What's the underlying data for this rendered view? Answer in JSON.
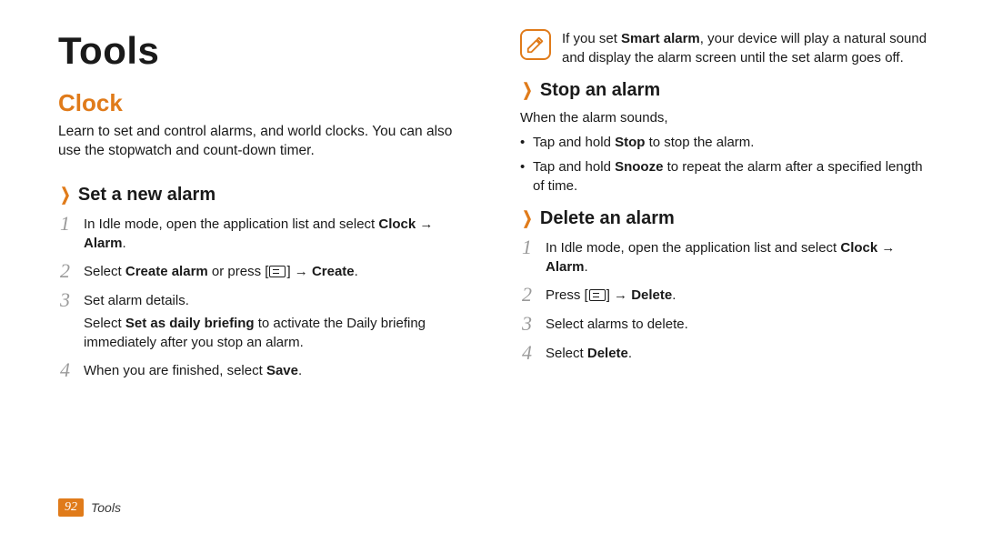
{
  "title": "Tools",
  "footer": {
    "pageNumber": "92",
    "sectionName": "Tools"
  },
  "left": {
    "heading": "Clock",
    "intro": "Learn to set and control alarms, and world clocks. You can also use the stopwatch and count-down timer.",
    "section1": {
      "title": "Set a new alarm",
      "steps": {
        "s1": {
          "pre": "In Idle mode, open the application list and select ",
          "b1": "Clock",
          "mid": " → ",
          "b2": "Alarm",
          "post": "."
        },
        "s2": {
          "pre": "Select ",
          "b1": "Create alarm",
          "mid": " or press [",
          "post": "] → ",
          "b2": "Create",
          "end": "."
        },
        "s3": {
          "line1": "Set alarm details.",
          "extraPre": "Select ",
          "extraB": "Set as daily briefing",
          "extraPost": " to activate the Daily briefing immediately after you stop an alarm."
        },
        "s4": {
          "pre": "When you are finished, select ",
          "b1": "Save",
          "post": "."
        }
      }
    }
  },
  "right": {
    "note": {
      "pre": "If you set ",
      "b1": "Smart alarm",
      "post": ", your device will play a natural sound and display the alarm screen until the set alarm goes off."
    },
    "section2": {
      "title": "Stop an alarm",
      "intro": "When the alarm sounds,",
      "bullets": {
        "b1": {
          "pre": "Tap and hold ",
          "bold": "Stop",
          "post": " to stop the alarm."
        },
        "b2": {
          "pre": "Tap and hold ",
          "bold": "Snooze",
          "post": " to repeat the alarm after a specified length of time."
        }
      }
    },
    "section3": {
      "title": "Delete an alarm",
      "steps": {
        "s1": {
          "pre": "In Idle mode, open the application list and select ",
          "b1": "Clock",
          "mid": " → ",
          "b2": "Alarm",
          "post": "."
        },
        "s2": {
          "pre": "Press [",
          "post": "] → ",
          "b1": "Delete",
          "end": "."
        },
        "s3": {
          "text": "Select alarms to delete."
        },
        "s4": {
          "pre": "Select ",
          "b1": "Delete",
          "post": "."
        }
      }
    }
  }
}
